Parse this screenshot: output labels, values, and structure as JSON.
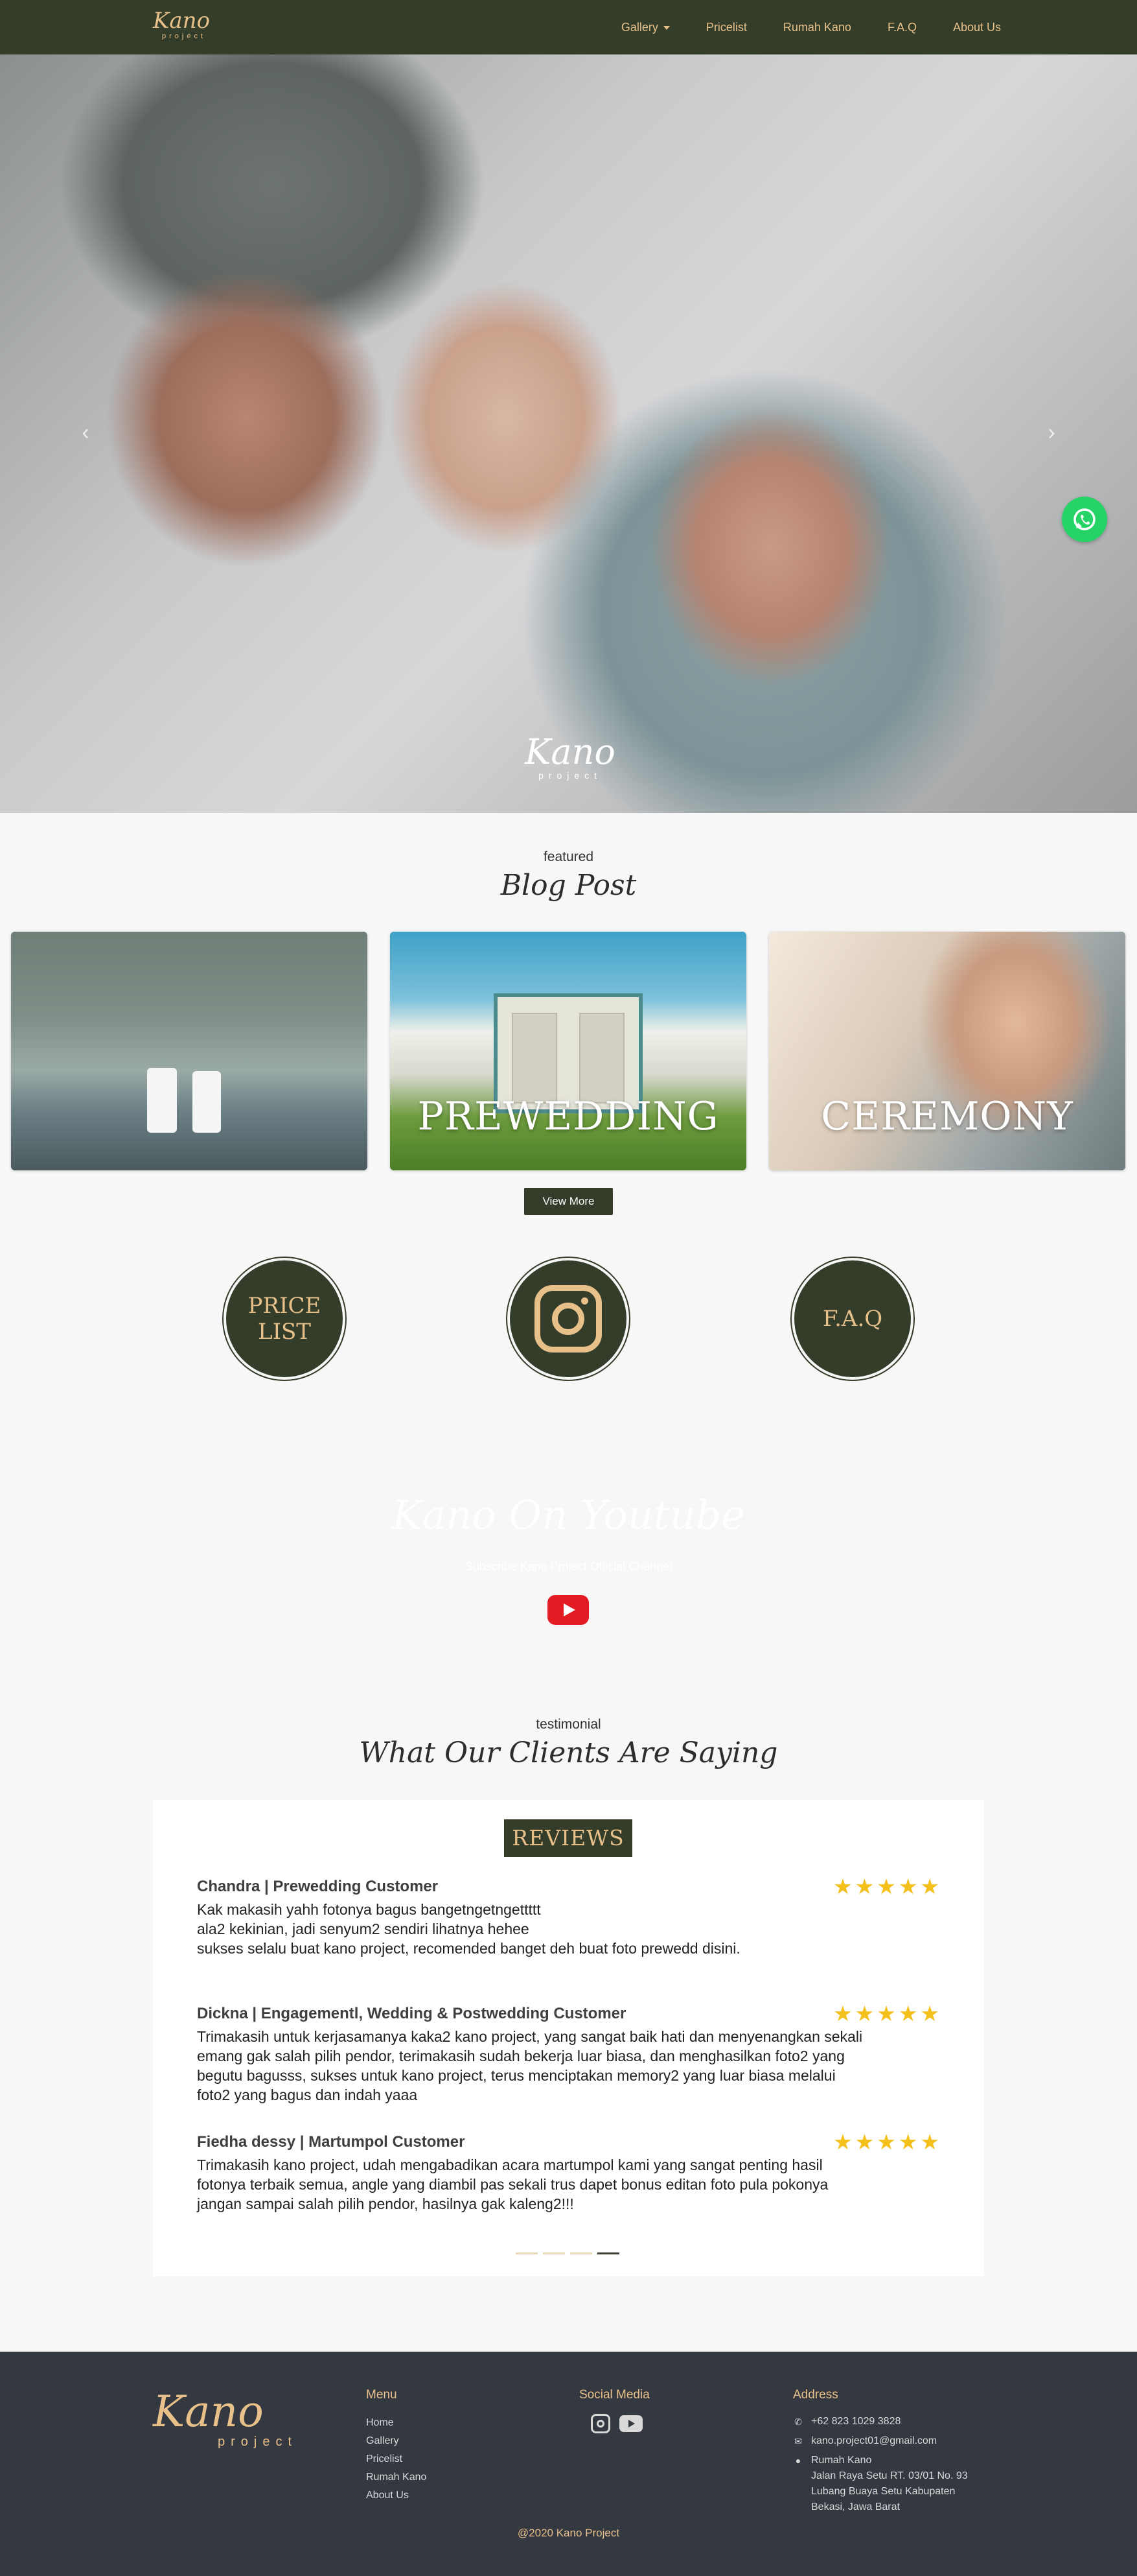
{
  "nav": {
    "logo_script": "Kano",
    "logo_sub": "project",
    "links": [
      "Gallery",
      "Pricelist",
      "Rumah Kano",
      "F.A.Q",
      "About Us"
    ]
  },
  "hero": {
    "prev_icon": "chevron-left-icon",
    "next_icon": "chevron-right-icon",
    "logo_script": "Kano",
    "logo_sub": "project",
    "whatsapp_icon": "whatsapp-icon"
  },
  "featured": {
    "label": "featured",
    "title": "Blog Post",
    "cards": [
      "",
      "PREWEDDING",
      "CEREMONY"
    ],
    "view_more": "View More"
  },
  "shortcuts": [
    "PRICE LIST",
    "instagram-icon",
    "F.A.Q"
  ],
  "youtube": {
    "title": "Kano On Youtube",
    "subtitle": "Subscribe Kano Project Official Channel",
    "icon": "youtube-icon"
  },
  "testimonial": {
    "label": "testimonial",
    "title": "What Our Clients Are Saying",
    "badge": "REVIEWS",
    "stars": "★★★★★",
    "reviews": [
      {
        "name": "Chandra | Prewedding Customer",
        "text": "Kak makasih yahh fotonya bagus bangetngetngettttt\nala2 kekinian, jadi senyum2 sendiri lihatnya hehee\nsukses selalu buat kano project, recomended banget deh buat foto prewedd disini."
      },
      {
        "name": "Dickna | Engagementl, Wedding & Postwedding Customer",
        "text": "Trimakasih untuk kerjasamanya kaka2 kano project, yang sangat baik hati dan menyenangkan sekali emang gak salah pilih pendor, terimakasih sudah bekerja luar biasa, dan menghasilkan foto2 yang begutu bagusss, sukses untuk kano project, terus menciptakan memory2 yang luar biasa melalui foto2 yang bagus dan indah yaaa"
      },
      {
        "name": "Fiedha dessy | Martumpol Customer",
        "text": "Trimakasih kano project, udah mengabadikan acara martumpol kami yang sangat penting hasil fotonya terbaik semua, angle yang diambil pas sekali trus dapet bonus editan foto pula pokonya jangan sampai salah pilih pendor, hasilnya gak kaleng2!!!"
      }
    ]
  },
  "footer": {
    "logo_script": "Kano",
    "logo_sub": "project",
    "menu_head": "Menu",
    "menu": [
      "Home",
      "Gallery",
      "Pricelist",
      "Rumah Kano",
      "About Us"
    ],
    "social_head": "Social Media",
    "address_head": "Address",
    "phone": "+62 823 1029 3828",
    "email": "kano.project01@gmail.com",
    "address_name": "Rumah Kano",
    "address_line1": "Jalan Raya Setu RT. 03/01 No. 93",
    "address_line2": "Lubang Buaya Setu Kabupaten",
    "address_line3": "Bekasi, Jawa Barat",
    "copyright": "@2020 Kano Project"
  },
  "colors": {
    "brand_dark": "#343d2a",
    "brand_gold": "#e8c08a",
    "footer_bg": "#343840",
    "star": "#f4c01c",
    "whatsapp": "#25d366",
    "youtube": "#e31b23"
  }
}
